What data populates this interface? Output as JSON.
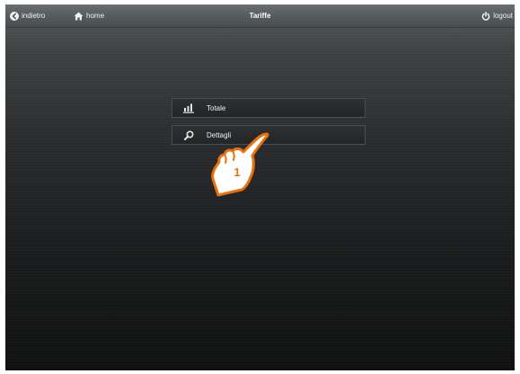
{
  "header": {
    "back_label": "indietro",
    "home_label": "home",
    "title": "Tariffe",
    "logout_label": "logout"
  },
  "menu": {
    "items": [
      {
        "label": "Totale",
        "icon": "bar-chart-icon"
      },
      {
        "label": "Dettagli",
        "icon": "search-icon"
      }
    ]
  },
  "annotation": {
    "number": "1",
    "color": "#e8710f"
  },
  "colors": {
    "topbar": "#555a5c",
    "background_top": "#3f4243",
    "background_bottom": "#0f1010",
    "menu_item": "#2a2c2d",
    "text": "#f0f0f0"
  }
}
